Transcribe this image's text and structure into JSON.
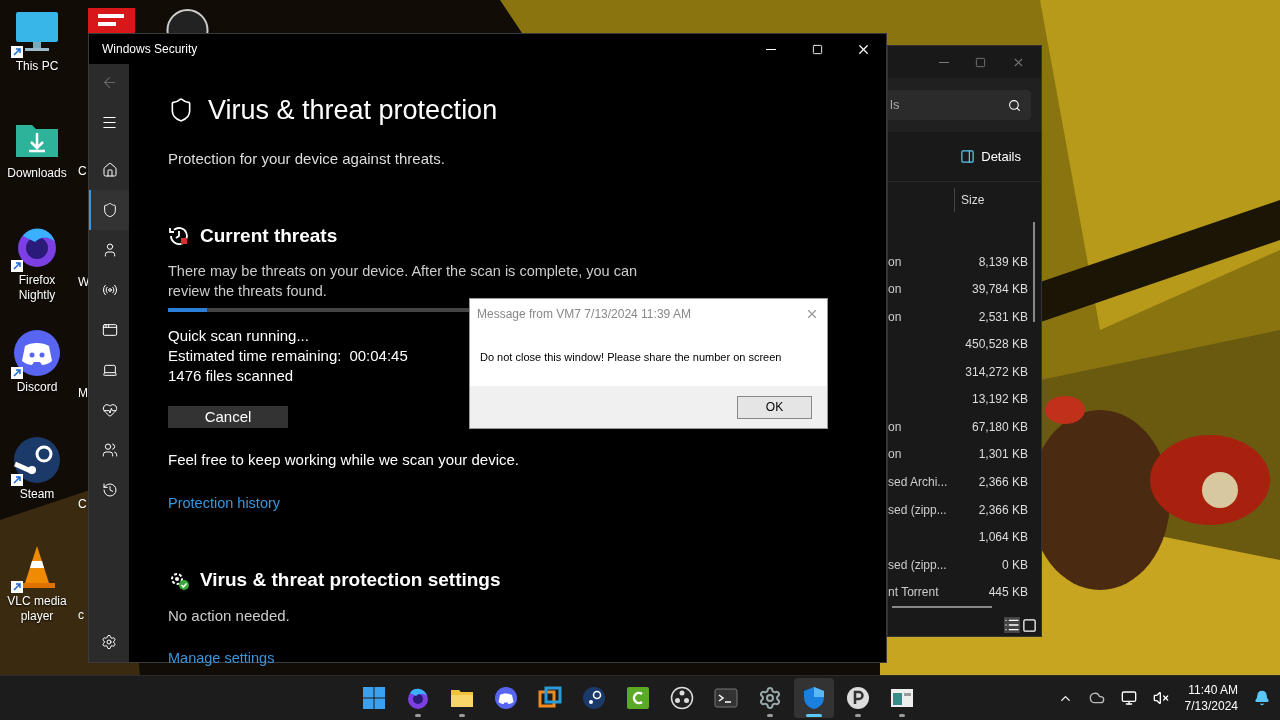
{
  "desktop": {
    "icons": [
      {
        "kind": "pc",
        "label": "This PC",
        "shortcut": true
      },
      {
        "kind": "folder",
        "label": "Downloads",
        "shortcut": false
      },
      {
        "kind": "firefox",
        "label": "Firefox Nightly",
        "shortcut": true
      },
      {
        "kind": "discord",
        "label": "Discord",
        "shortcut": true
      },
      {
        "kind": "steam",
        "label": "Steam",
        "shortcut": true
      },
      {
        "kind": "vlc",
        "label": "VLC media player",
        "shortcut": true
      }
    ],
    "hidden_labels": [
      "C",
      "W",
      "M",
      "C",
      "c"
    ]
  },
  "security_window": {
    "title": "Windows Security",
    "sidebar": {
      "items": [
        {
          "kind": "home",
          "selected": false
        },
        {
          "kind": "shield",
          "selected": true
        },
        {
          "kind": "account",
          "selected": false
        },
        {
          "kind": "network",
          "selected": false
        },
        {
          "kind": "app",
          "selected": false
        },
        {
          "kind": "device",
          "selected": false
        },
        {
          "kind": "health",
          "selected": false
        },
        {
          "kind": "family",
          "selected": false
        },
        {
          "kind": "history",
          "selected": false
        }
      ]
    },
    "heading": "Virus & threat protection",
    "subtitle": "Protection for your device against threats.",
    "current_threats": {
      "title": "Current threats",
      "description": "There may be threats on your device. After the scan is complete, you can review the threats found.",
      "progress": {
        "level": 0.08
      },
      "status": "Quick scan running...",
      "time_label": "Estimated time remaining:",
      "time_value": "00:04:45",
      "files": "1476 files scanned",
      "cancel": "Cancel",
      "note": "Feel free to keep working while we scan your device.",
      "link": "Protection history"
    },
    "settings": {
      "title": "Virus & threat protection settings",
      "status": "No action needed.",
      "link": "Manage settings"
    }
  },
  "explorer_window": {
    "search": "ls",
    "view_button": "Details",
    "columns": [
      "Size"
    ],
    "rows": [
      {
        "type": "on",
        "size": "8,139 KB"
      },
      {
        "type": "on",
        "size": "39,784 KB"
      },
      {
        "type": "on",
        "size": "2,531 KB"
      },
      {
        "type": "",
        "size": "450,528 KB"
      },
      {
        "type": "",
        "size": "314,272 KB"
      },
      {
        "type": "",
        "size": "13,192 KB"
      },
      {
        "type": "on",
        "size": "67,180 KB"
      },
      {
        "type": "on",
        "size": "1,301 KB"
      },
      {
        "type": "sed Archi...",
        "size": "2,366 KB"
      },
      {
        "type": "sed (zipp...",
        "size": "2,366 KB"
      },
      {
        "type": "",
        "size": "1,064 KB"
      },
      {
        "type": "sed (zipp...",
        "size": "0 KB"
      },
      {
        "type": "nt Torrent",
        "size": "445 KB"
      }
    ]
  },
  "message_box": {
    "title": "Message from VM7 7/13/2024 11:39 AM",
    "text": "Do not close this window! Please share the number on screen",
    "button": "OK"
  },
  "taskbar": {
    "apps": [
      {
        "kind": "start",
        "running": false,
        "selected": false
      },
      {
        "kind": "firefox",
        "running": true,
        "selected": false
      },
      {
        "kind": "files",
        "running": true,
        "selected": false
      },
      {
        "kind": "discord",
        "running": false,
        "selected": false
      },
      {
        "kind": "vm",
        "running": false,
        "selected": false
      },
      {
        "kind": "steam",
        "running": false,
        "selected": false
      },
      {
        "kind": "camtasia",
        "running": false,
        "selected": false
      },
      {
        "kind": "obs",
        "running": false,
        "selected": false
      },
      {
        "kind": "terminal",
        "running": false,
        "selected": false
      },
      {
        "kind": "settings",
        "running": true,
        "selected": false
      },
      {
        "kind": "defender",
        "running": true,
        "selected": true
      },
      {
        "kind": "proxy",
        "running": true,
        "selected": false
      },
      {
        "kind": "window",
        "running": true,
        "selected": false
      }
    ],
    "time": "11:40 AM",
    "date": "7/13/2024"
  }
}
